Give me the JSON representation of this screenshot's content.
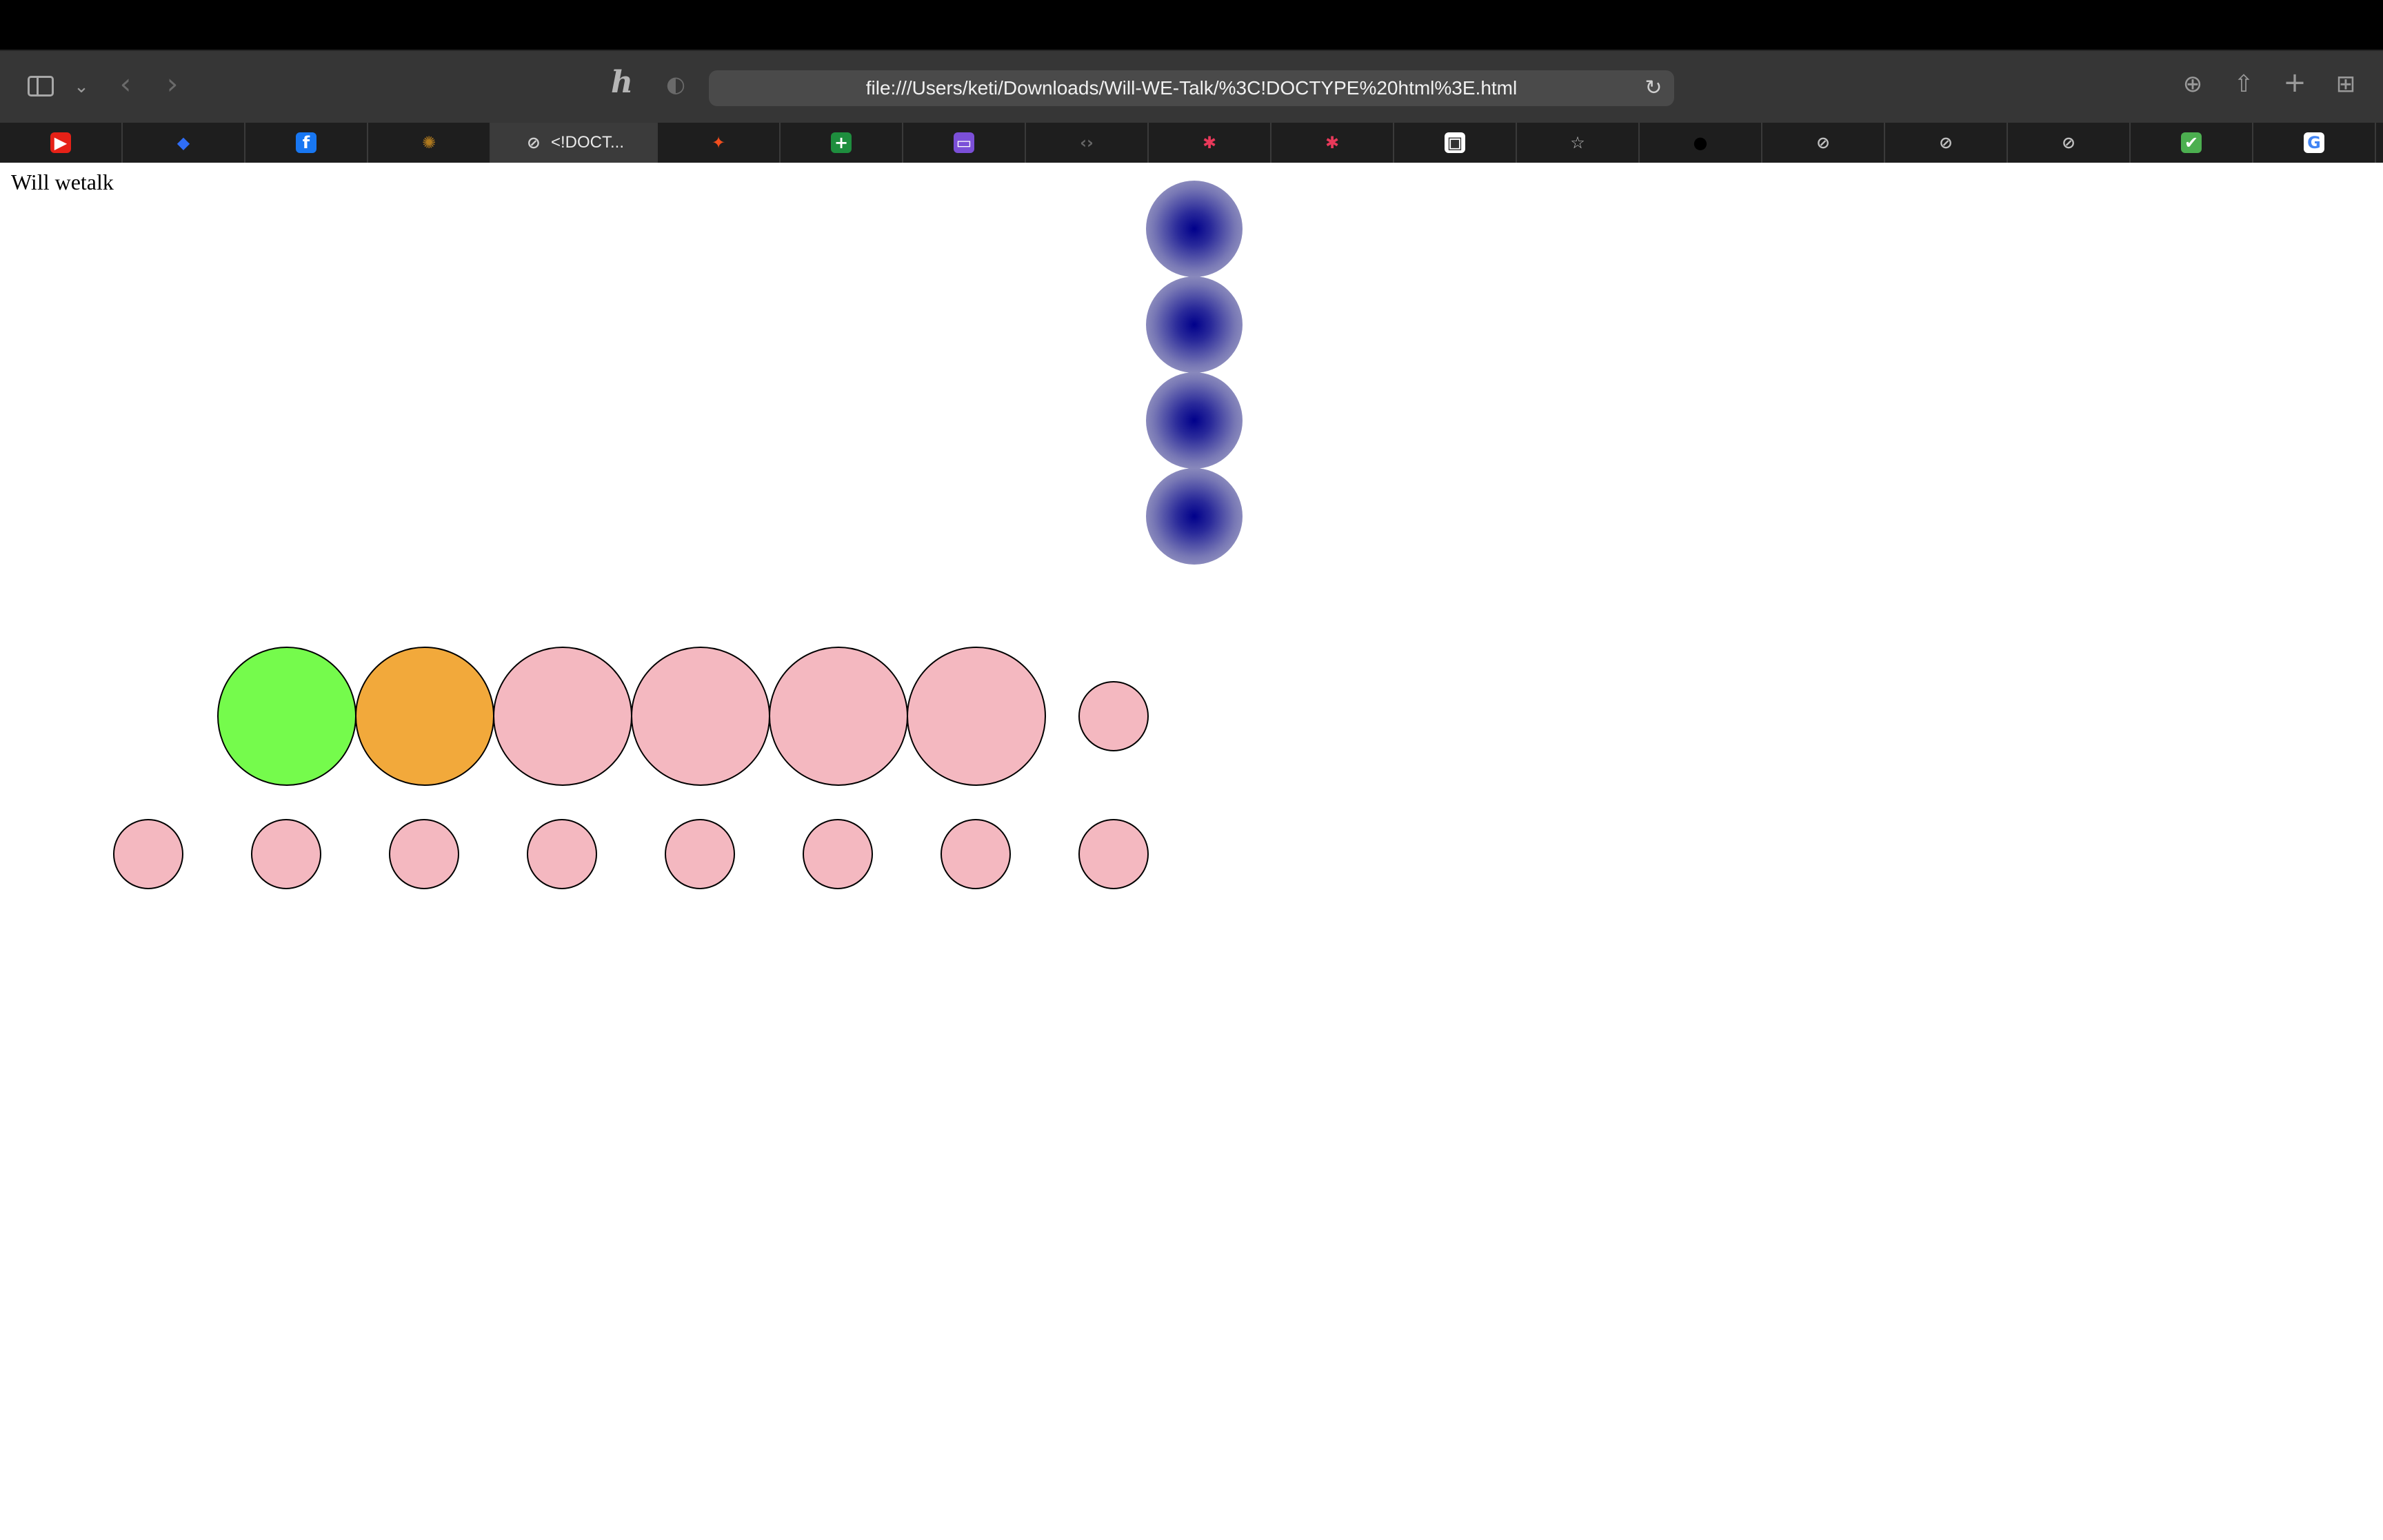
{
  "browser": {
    "url": "file:///Users/keti/Downloads/Will-WE-Talk/%3C!DOCTYPE%20html%3E.html",
    "active_tab_title": "<!DOCT..."
  },
  "icons": {
    "sidebar": "sidebar-icon",
    "back": "back-arrow-icon",
    "forward": "forward-arrow-icon",
    "honey": "honey-extension-icon",
    "shield": "privacy-shield-icon",
    "reload": "reload-icon",
    "downloads": "downloads-icon",
    "share": "share-icon",
    "new_tab": "plus-icon",
    "tab_overview": "tab-overview-icon"
  },
  "tabs": [
    {
      "name": "youtube-tab",
      "icon": "youtube-icon",
      "glyph": "▶",
      "bg": "#e62117",
      "color": "#ffffff"
    },
    {
      "name": "dropbox-tab",
      "icon": "dropbox-icon",
      "glyph": "◆",
      "bg": "transparent",
      "color": "#2f6df6"
    },
    {
      "name": "facebook-tab",
      "icon": "facebook-icon",
      "glyph": "f",
      "bg": "#1877f2",
      "color": "#ffffff"
    },
    {
      "name": "sketch-tab",
      "icon": "circle-logo-icon",
      "glyph": "✺",
      "bg": "transparent",
      "color": "#b07a1e"
    },
    {
      "name": "current-tab",
      "icon": "compass-icon",
      "glyph": "⊘",
      "bg": "transparent",
      "color": "#d0d0d0",
      "active": true
    },
    {
      "name": "figma-tab",
      "icon": "figma-icon",
      "glyph": "✦",
      "bg": "transparent",
      "color": "#f24e1e"
    },
    {
      "name": "sheets-tab",
      "icon": "sheets-icon",
      "glyph": "+",
      "bg": "#1e8e3e",
      "color": "#ffffff"
    },
    {
      "name": "slides-tab",
      "icon": "slides-icon",
      "glyph": "▭",
      "bg": "#7b4fd8",
      "color": "#ffffff"
    },
    {
      "name": "code-tab",
      "icon": "code-icon",
      "glyph": "‹›",
      "bg": "transparent",
      "color": "#666666"
    },
    {
      "name": "asterisk-tab-1",
      "icon": "asterisk-icon",
      "glyph": "✱",
      "bg": "transparent",
      "color": "#e8395a"
    },
    {
      "name": "asterisk-tab-2",
      "icon": "asterisk-icon",
      "glyph": "✱",
      "bg": "transparent",
      "color": "#e8395a"
    },
    {
      "name": "screenshot-tab",
      "icon": "image-icon",
      "glyph": "▣",
      "bg": "#ffffff",
      "color": "#333333"
    },
    {
      "name": "bookmark-tab",
      "icon": "star-icon",
      "glyph": "☆",
      "bg": "transparent",
      "color": "#bfbfbf"
    },
    {
      "name": "github-tab",
      "icon": "github-icon",
      "glyph": "●",
      "bg": "transparent",
      "color": "#000000"
    },
    {
      "name": "compass-tab-1",
      "icon": "compass-icon",
      "glyph": "⊘",
      "bg": "transparent",
      "color": "#bfbfbf"
    },
    {
      "name": "compass-tab-2",
      "icon": "compass-icon",
      "glyph": "⊘",
      "bg": "transparent",
      "color": "#bfbfbf"
    },
    {
      "name": "compass-tab-3",
      "icon": "compass-icon",
      "glyph": "⊘",
      "bg": "transparent",
      "color": "#bfbfbf"
    },
    {
      "name": "green-logo-tab",
      "icon": "green-logo-icon",
      "glyph": "✔",
      "bg": "#4caf50",
      "color": "#ffffff"
    },
    {
      "name": "google-tab",
      "icon": "google-icon",
      "glyph": "G",
      "bg": "#ffffff",
      "color": "#4285f4"
    }
  ],
  "page": {
    "text": "Will wetalk",
    "colors": {
      "green": "#75fb4c",
      "orange": "#f2a93b",
      "pink": "#f4b8c0",
      "blue": "#00008b"
    },
    "blue_dots": 4,
    "large_circles": [
      "green",
      "orange",
      "pink",
      "pink",
      "pink",
      "pink"
    ],
    "small_circles_row1": 1,
    "small_circles_row2": 8
  }
}
